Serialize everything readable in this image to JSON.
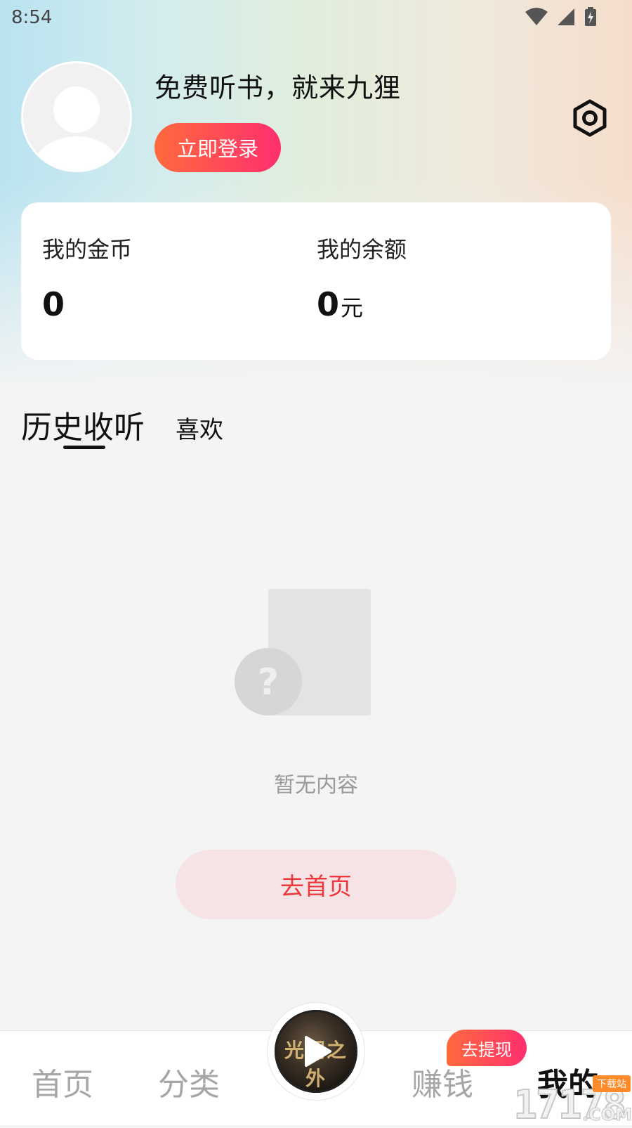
{
  "status_bar": {
    "time": "8:54",
    "icons": [
      "wifi-icon",
      "cell-signal-icon",
      "battery-charging-icon"
    ]
  },
  "profile": {
    "slogan": "免费听书，就来九狸",
    "login_button": "立即登录",
    "settings_icon": "settings-hexagon-icon"
  },
  "wallet": {
    "coins_label": "我的金币",
    "coins_value": "0",
    "balance_label": "我的余额",
    "balance_value": "0",
    "balance_unit": "元"
  },
  "tabs": {
    "history": "历史收听",
    "likes": "喜欢"
  },
  "empty_state": {
    "message": "暂无内容",
    "button": "去首页"
  },
  "player": {
    "cover_text": "光阴之外"
  },
  "bottom_nav": {
    "items": [
      "首页",
      "分类",
      "赚钱",
      "我的"
    ],
    "active": "我的",
    "badge": "去提现"
  },
  "watermark": {
    "text": "17178",
    "tag": "下载站",
    "suffix": ".COM"
  },
  "colors": {
    "accent_gradient_start": "#ff6a3d",
    "accent_gradient_end": "#ff2f6e",
    "home_button_text": "#f0353d",
    "home_button_bg": "#f6e3e5"
  }
}
